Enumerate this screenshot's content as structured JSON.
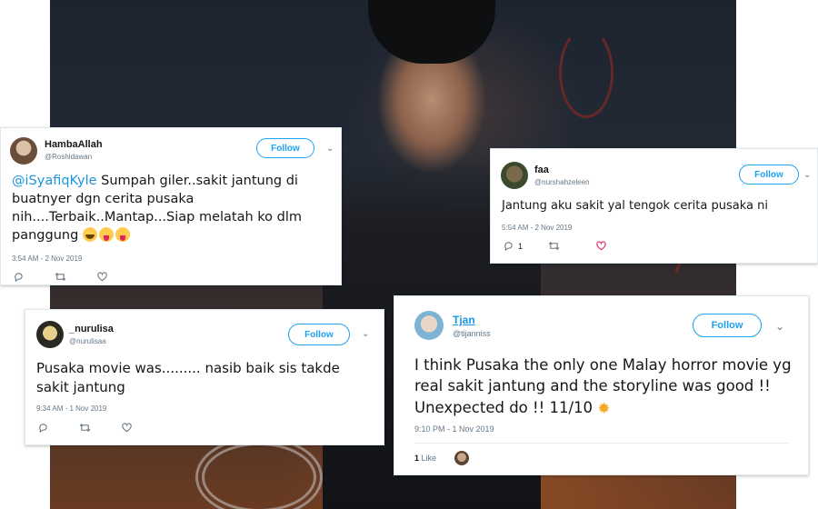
{
  "tweets": [
    {
      "name": "HambaAllah",
      "handle": "@Roshidawan",
      "follow_label": "Follow",
      "text_mention": "@iSyafiqKyle",
      "text_body": " Sumpah giler..sakit jantung di buatnyer dgn cerita pusaka nih....Terbaik..Mantap...Siap melatah ko dlm panggung",
      "emojis": [
        "face-with-tears-of-joy",
        "face-with-tongue",
        "face-with-tongue"
      ],
      "timestamp": "3:54 AM - 2 Nov 2019",
      "replies": "",
      "likes": ""
    },
    {
      "name": "faa",
      "handle": "@nurshahzeleen",
      "follow_label": "Follow",
      "text_body": "Jantung aku sakit yal tengok cerita pusaka ni",
      "timestamp": "5:54 AM - 2 Nov 2019",
      "replies": "1",
      "likes": ""
    },
    {
      "name": "_nurulisa",
      "handle": "@nurulisaa",
      "follow_label": "Follow",
      "text_body": "Pusaka movie was......... nasib baik sis takde sakit jantung",
      "timestamp": "9:34 AM - 1 Nov 2019",
      "replies": "",
      "likes": ""
    },
    {
      "name": "Tjan",
      "handle": "@tijanniss",
      "follow_label": "Follow",
      "text_body": "I think Pusaka the only one Malay horror movie yg real sakit jantung and the storyline was good !! Unexpected do !! 11/10",
      "emojis": [
        "glowing-star"
      ],
      "timestamp": "9:10 PM - 1 Nov 2019",
      "likes_count": "1",
      "likes_label": "Like"
    }
  ],
  "colors": {
    "accent": "#1da1f2",
    "mention": "#1b95e0",
    "muted": "#657786",
    "like_heart": "#e0245e"
  },
  "icons": [
    "reply-icon",
    "retweet-icon",
    "like-icon",
    "chevron-down-icon",
    "star-emoji"
  ]
}
